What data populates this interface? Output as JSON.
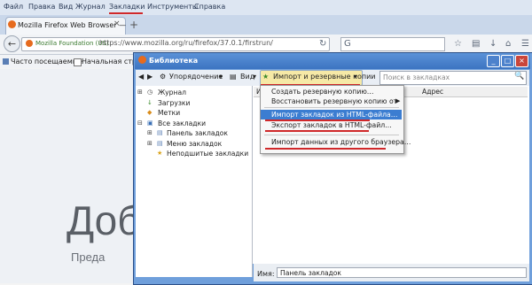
{
  "menubar": [
    "Файл",
    "Правка",
    "Вид",
    "Журнал",
    "Закладки",
    "Инструменты",
    "Справка"
  ],
  "tab": {
    "title": "Mozilla Firefox Web Browser —",
    "close": "×",
    "new": "+"
  },
  "urlbar": {
    "site": "Mozilla Foundation (US)",
    "url": "https://www.mozilla.org/ru/firefox/37.0.1/firstrun/"
  },
  "bookmarks_toolbar": [
    "Часто посещаемые",
    "Начальная стран"
  ],
  "page": {
    "heading": "Доб",
    "subheading": "Преда"
  },
  "library": {
    "title": "Библиотека",
    "toolbar": {
      "organize": "Упорядочение",
      "view": "Вид",
      "import": "Импорт и резервные копии",
      "search_placeholder": "Поиск в закладках"
    },
    "tree": [
      "Журнал",
      "Загрузки",
      "Метки",
      "Все закладки",
      "Панель закладок",
      "Меню закладок",
      "Неподшитые закладки"
    ],
    "columns": [
      "Им",
      "Адрес"
    ],
    "footer": {
      "name_label": "Имя:",
      "name_value": "Панель закладок"
    }
  },
  "import_menu": [
    "Создать резервную копию…",
    "Восстановить резервную копию от",
    "Импорт закладок из HTML-файла…",
    "Экспорт закладок в HTML-файл…",
    "Импорт данных из другого браузера…"
  ],
  "colors": {
    "highlight": "#3b7dd1",
    "annotation_red": "#d0282a",
    "titlebar": "#3c74c1"
  }
}
